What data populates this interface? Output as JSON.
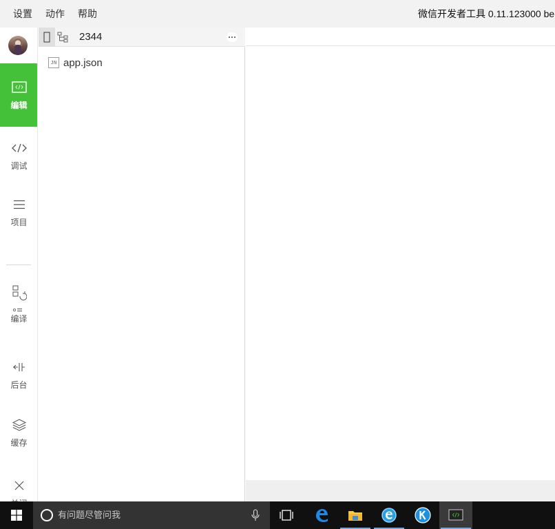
{
  "menubar": {
    "items": [
      "设置",
      "动作",
      "帮助"
    ],
    "app_title": "微信开发者工具 0.11.123000 be"
  },
  "sidebar": {
    "items": [
      {
        "label": "编辑",
        "icon": "code-box-icon",
        "active": true
      },
      {
        "label": "调试",
        "icon": "code-brackets-icon"
      },
      {
        "label": "项目",
        "icon": "menu-lines-icon"
      },
      {
        "label": "编译",
        "icon": "compile-icon"
      },
      {
        "label": "后台",
        "icon": "backend-icon"
      },
      {
        "label": "缓存",
        "icon": "layers-icon"
      },
      {
        "label": "关闭",
        "icon": "close-icon"
      }
    ]
  },
  "filepanel": {
    "project_name": "2344",
    "files": [
      {
        "name": "app.json",
        "icon_text": "JN"
      }
    ]
  },
  "taskbar": {
    "search_placeholder": "有问题尽管问我",
    "apps": [
      "task-view",
      "edge",
      "file-explorer",
      "ie",
      "k-app",
      "devtools"
    ]
  },
  "colors": {
    "accent_green": "#45c039",
    "taskbar_bg": "#101010",
    "menubar_bg": "#f2f2f2"
  }
}
